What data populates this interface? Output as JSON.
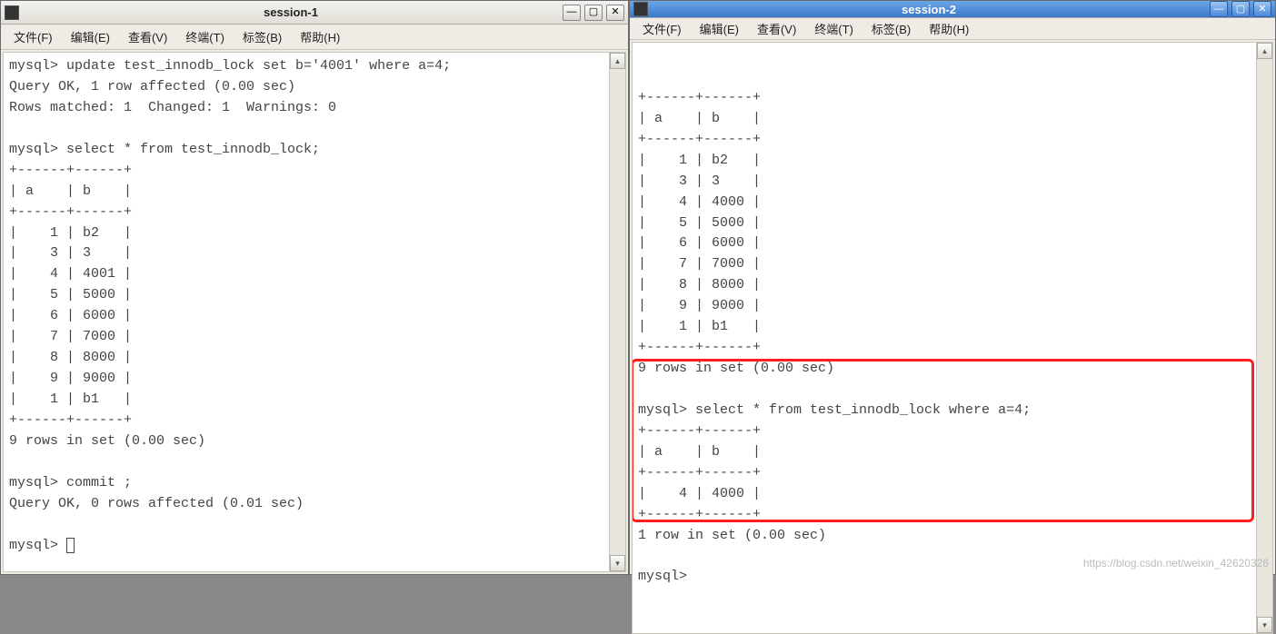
{
  "session1": {
    "title": "session-1",
    "menu": [
      "文件(F)",
      "编辑(E)",
      "查看(V)",
      "终端(T)",
      "标签(B)",
      "帮助(H)"
    ],
    "lines": [
      "mysql> update test_innodb_lock set b='4001' where a=4;",
      "Query OK, 1 row affected (0.00 sec)",
      "Rows matched: 1  Changed: 1  Warnings: 0",
      "",
      "mysql> select * from test_innodb_lock;",
      "+------+------+",
      "| a    | b    |",
      "+------+------+",
      "|    1 | b2   |",
      "|    3 | 3    |",
      "|    4 | 4001 |",
      "|    5 | 5000 |",
      "|    6 | 6000 |",
      "|    7 | 7000 |",
      "|    8 | 8000 |",
      "|    9 | 9000 |",
      "|    1 | b1   |",
      "+------+------+",
      "9 rows in set (0.00 sec)",
      "",
      "mysql> commit ;",
      "Query OK, 0 rows affected (0.01 sec)",
      "",
      "mysql> "
    ]
  },
  "session2": {
    "title": "session-2",
    "menu": [
      "文件(F)",
      "编辑(E)",
      "查看(V)",
      "终端(T)",
      "标签(B)",
      "帮助(H)"
    ],
    "lines": [
      "+------+------+",
      "| a    | b    |",
      "+------+------+",
      "|    1 | b2   |",
      "|    3 | 3    |",
      "|    4 | 4000 |",
      "|    5 | 5000 |",
      "|    6 | 6000 |",
      "|    7 | 7000 |",
      "|    8 | 8000 |",
      "|    9 | 9000 |",
      "|    1 | b1   |",
      "+------+------+",
      "9 rows in set (0.00 sec)",
      "",
      "mysql> select * from test_innodb_lock where a=4;",
      "+------+------+",
      "| a    | b    |",
      "+------+------+",
      "|    4 | 4000 |",
      "+------+------+",
      "1 row in set (0.00 sec)",
      "",
      "mysql>"
    ]
  },
  "watermark": "https://blog.csdn.net/weixin_42620326",
  "glyphs": {
    "min": "—",
    "max": "▢",
    "close": "✕",
    "up": "▴",
    "down": "▾"
  }
}
